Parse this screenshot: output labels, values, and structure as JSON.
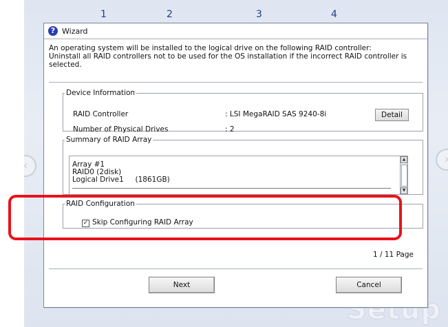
{
  "background": {
    "steps": [
      "1",
      "2",
      "3",
      "4"
    ],
    "watermark": "Setup",
    "accent_color": "#1f3d8a"
  },
  "wizard": {
    "title": "Wizard",
    "icon": "help-question-icon",
    "message_lines": [
      "An operating system will be installed to the logical drive on the following RAID controller:",
      "Uninstall all RAID controllers not to be used for the OS installation if the incorrect RAID controller is",
      "selected."
    ],
    "device_info": {
      "legend": "Device Information",
      "raid_controller_label": "RAID Controller",
      "raid_controller_value": ":  LSI MegaRAID SAS 9240-8i",
      "detail_button": "Detail",
      "physical_drives_label": "Number of Physical Drives",
      "physical_drives_value": ":  2"
    },
    "summary": {
      "legend": "Summary of RAID Array",
      "lines": [
        "Array #1",
        "RAID0 (2disk)",
        "Logical Drive1     (1861GB)"
      ]
    },
    "raid_config": {
      "legend": "RAID Configuration",
      "checkbox_label": "Skip Configuring RAID Array",
      "checked": true
    },
    "page_indicator": "1 / 11 Page",
    "buttons": {
      "next": "Next",
      "cancel": "Cancel"
    }
  },
  "highlight_color": "#e8121a"
}
